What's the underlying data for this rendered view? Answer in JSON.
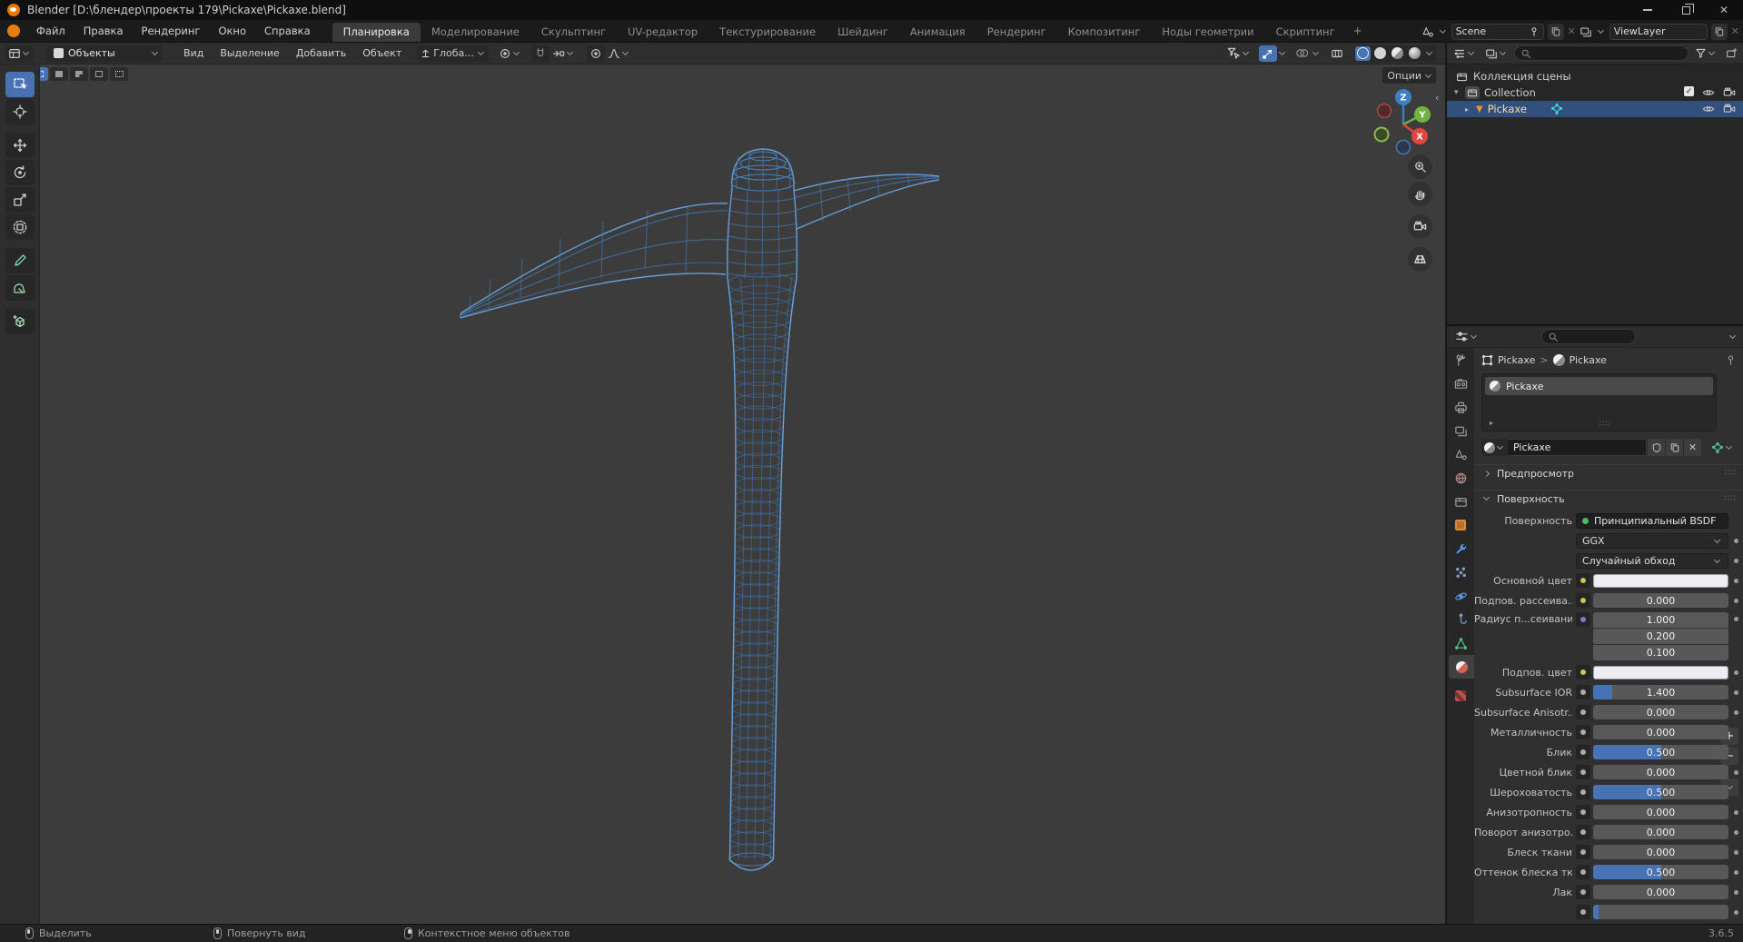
{
  "window": {
    "title": "Blender [D:\\блендер\\проекты 179\\Pickaxe\\Pickaxe.blend]"
  },
  "topbar": {
    "menus": [
      {
        "label": "Файл"
      },
      {
        "label": "Правка"
      },
      {
        "label": "Рендеринг"
      },
      {
        "label": "Окно"
      },
      {
        "label": "Справка"
      }
    ],
    "tabs": [
      {
        "label": "Планировка",
        "active": true
      },
      {
        "label": "Моделирование"
      },
      {
        "label": "Скульптинг"
      },
      {
        "label": "UV-редактор"
      },
      {
        "label": "Текстурирование"
      },
      {
        "label": "Шейдинг"
      },
      {
        "label": "Анимация"
      },
      {
        "label": "Рендеринг"
      },
      {
        "label": "Композитинг"
      },
      {
        "label": "Ноды геометрии"
      },
      {
        "label": "Скриптинг"
      }
    ],
    "add_tab": "+",
    "scene_name": "Scene",
    "view_layer_name": "ViewLayer"
  },
  "viewport": {
    "mode": "Объекты",
    "menus": [
      {
        "label": "Вид"
      },
      {
        "label": "Выделение"
      },
      {
        "label": "Добавить"
      },
      {
        "label": "Объект"
      }
    ],
    "orientation": "Глоба...",
    "options_label": "Опции",
    "axes": {
      "z": "Z",
      "y": "Y",
      "x": "X"
    }
  },
  "outliner": {
    "rows": [
      {
        "label": "Коллекция сцены"
      },
      {
        "label": "Collection"
      },
      {
        "label": "Pickaxe"
      }
    ]
  },
  "properties": {
    "breadcrumb": {
      "object": "Pickaxe",
      "separator": ">",
      "material": "Pickaxe"
    },
    "slot": {
      "name": "Pickaxe"
    },
    "name_field": "Pickaxe",
    "panels": {
      "preview": "Предпросмотр",
      "surface": "Поверхность"
    },
    "rows": [
      {
        "label": "Поверхность",
        "value": "Принципиальный BSDF"
      },
      {
        "value": "GGX"
      },
      {
        "value": "Случайный обход"
      },
      {
        "label": "Основной цвет",
        "swatch": "#ededf2"
      },
      {
        "label": "Подпов. рассеива...",
        "value": "0.000",
        "fill": 0
      },
      {
        "label": "Радиус п...сеивания",
        "values": [
          "1.000",
          "0.200",
          "0.100"
        ]
      },
      {
        "label": "Подпов. цвет",
        "swatch": "#ededf2"
      },
      {
        "label": "Subsurface IOR",
        "value": "1.400",
        "fill": 0.14
      },
      {
        "label": "Subsurface Anisotr...",
        "value": "0.000",
        "fill": 0
      },
      {
        "label": "Металличность",
        "value": "0.000",
        "fill": 0
      },
      {
        "label": "Блик",
        "value": "0.500",
        "fill": 0.5
      },
      {
        "label": "Цветной блик",
        "value": "0.000",
        "fill": 0
      },
      {
        "label": "Шероховатость",
        "value": "0.500",
        "fill": 0.5
      },
      {
        "label": "Анизотропность",
        "value": "0.000",
        "fill": 0
      },
      {
        "label": "Поворот анизотро...",
        "value": "0.000",
        "fill": 0
      },
      {
        "label": "Блеск ткани",
        "value": "0.000",
        "fill": 0
      },
      {
        "label": "Оттенок блеска тк...",
        "value": "0.500",
        "fill": 0.5
      },
      {
        "label": "Лак",
        "value": "0.000",
        "fill": 0
      },
      {
        "label": "",
        "value": "",
        "fill": 0.04
      }
    ]
  },
  "statusbar": {
    "hints": [
      {
        "label": "Выделить"
      },
      {
        "label": "Повернуть вид"
      },
      {
        "label": "Контекстное меню объектов"
      }
    ],
    "version": "3.6.5"
  },
  "colors": {
    "accent": "#4772b3",
    "wireframe": "#4688cc",
    "selection_row": "#31507c",
    "axis_x": "#e2453c",
    "axis_y": "#6fb33f",
    "axis_z": "#3b7fc4",
    "object_orange": "#d98c3c",
    "mesh_teal": "#46d4c8"
  }
}
